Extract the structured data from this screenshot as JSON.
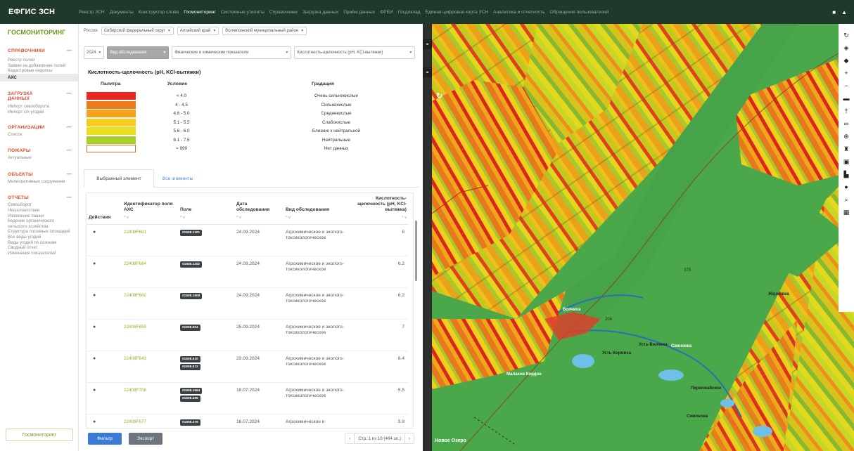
{
  "app": {
    "brand": "ЕФГИС ЗСН",
    "nav": [
      "Реестр ЗСН",
      "Документы",
      "Конструктор слоёв",
      "Госмониторинг",
      "Системные утилиты",
      "Справочники",
      "Загрузка данных",
      "Приём данных",
      "ФРЕИ",
      "Госдоклад",
      "Единая цифровая карта ЗСН",
      "Аналитика и отчетность",
      "Обращения пользователей"
    ],
    "active_nav": "Госмониторинг"
  },
  "sidebar": {
    "title": "ГОСМОНИТОРИНГ",
    "sections": [
      {
        "label": "СПРАВОЧНИКИ",
        "items": [
          "Реестр полей",
          "Заявки на добавление полей",
          "Кадастровые недопсы",
          "АХС"
        ]
      },
      {
        "label": "ЗАГРУЗКА ДАННЫХ",
        "items": [
          "Импорт севооборота",
          "Импорт с/х угодий"
        ]
      },
      {
        "label": "ОРГАНИЗАЦИИ",
        "items": [
          "Список"
        ]
      },
      {
        "label": "ПОЖАРЫ",
        "items": [
          "Актуальные"
        ]
      },
      {
        "label": "ОБЪЕКТЫ",
        "items": [
          "Мелиоративные сооружения"
        ]
      },
      {
        "label": "ОТЧЕТЫ",
        "items": [
          "Севооборот",
          "Несоответствия",
          "Изменение пашни",
          "Ведение органического сельского хозяйства",
          "Структура посевных площадей",
          "Все виды угодий",
          "Виды угодий по сезонам",
          "Сводный отчет",
          "Изменения показателей"
        ]
      }
    ],
    "active_item": "АХС",
    "bottom_button": "Госмониторинг"
  },
  "filters": {
    "region_label": "Россия",
    "region": "Сибирский федеральный округ",
    "subject": "Алтайский край",
    "district": "Волчихинский муниципальный район",
    "year": "2024",
    "survey_type": "Вид обследования",
    "indicator_group": "Физические и химические показатели",
    "indicator": "Кислотность-щелочность (pH, KCl-вытяжки)"
  },
  "legend": {
    "title": "Кислотность-щелочность (pH, KCl-вытяжки)",
    "col_palette": "Палитра",
    "col_condition": "Условие",
    "col_gradation": "Градация",
    "rows": [
      {
        "color": "#e8271e",
        "condition": "< 4.0",
        "gradation": "Очень сильнокислые"
      },
      {
        "color": "#ee7a1c",
        "condition": "4 - 4.5",
        "gradation": "Сильнокислые"
      },
      {
        "color": "#f4a21a",
        "condition": "4.6 - 5.0",
        "gradation": "Среднекислые"
      },
      {
        "color": "#f7cc1c",
        "condition": "5.1 - 5.5",
        "gradation": "Слабокислые"
      },
      {
        "color": "#e7e11d",
        "condition": "5.6 - 6.0",
        "gradation": "Близкие к нейтральной"
      },
      {
        "color": "#a9cf2e",
        "condition": "6.1 - 7.5",
        "gradation": "Нейтральные"
      },
      {
        "color": "#ffffff",
        "condition": "= 999",
        "gradation": "Нет данных"
      }
    ]
  },
  "tabs": {
    "selected": "Выбранный элемент",
    "all": "Все элементы"
  },
  "table": {
    "headers": {
      "actions": "Действия",
      "field_id": "Идентификатор поля АХС",
      "field": "Поле",
      "date": "Дата обследования",
      "survey": "Вид обследования",
      "value": "Кислотность-щелочность (pH, KCl-вытяжка)"
    },
    "rows": [
      {
        "field_id": "22408F681",
        "fields": [
          "01608.1101"
        ],
        "date": "24.09.2024",
        "survey": "Агрохимическое и эколого-токсикологическое",
        "value": "6"
      },
      {
        "field_id": "22408F684",
        "fields": [
          "01608.1102"
        ],
        "date": "24.09.2024",
        "survey": "Агрохимическое и эколого-токсикологическое",
        "value": "6.2"
      },
      {
        "field_id": "22408F682",
        "fields": [
          "01608.1608"
        ],
        "date": "24.09.2024",
        "survey": "Агрохимическое и эколого-токсикологическое",
        "value": "6.2"
      },
      {
        "field_id": "22408F659",
        "fields": [
          "01608.504"
        ],
        "date": "25.09.2024",
        "survey": "Агрохимическое и эколого-токсикологическое",
        "value": "7"
      },
      {
        "field_id": "22408F643",
        "fields": [
          "01608.510",
          "01608.512"
        ],
        "date": "23.09.2024",
        "survey": "Агрохимическое и эколого-токсикологическое",
        "value": "6.4"
      },
      {
        "field_id": "22408F706",
        "fields": [
          "01608.1664",
          "01608.495"
        ],
        "date": "18.07.2024",
        "survey": "Агрохимическое и эколого-токсикологическое",
        "value": "5.5"
      },
      {
        "field_id": "22408F677",
        "fields": [
          "01608.479"
        ],
        "date": "16.07.2024",
        "survey": "Агрохимическое и",
        "value": "5.9"
      }
    ]
  },
  "bottom": {
    "filter": "Фильтр",
    "export": "Экспорт",
    "pager": "Стр. 1 из 10 (464 эл.)"
  },
  "map": {
    "labels": [
      "Волчиха",
      "Усть-Волчиха",
      "Жерновка",
      "Малахов Кордон",
      "Первомайское",
      "Новое Озеро",
      "Свиновка",
      "Симонова",
      "204",
      "373",
      "Усть-Кормиха"
    ]
  }
}
